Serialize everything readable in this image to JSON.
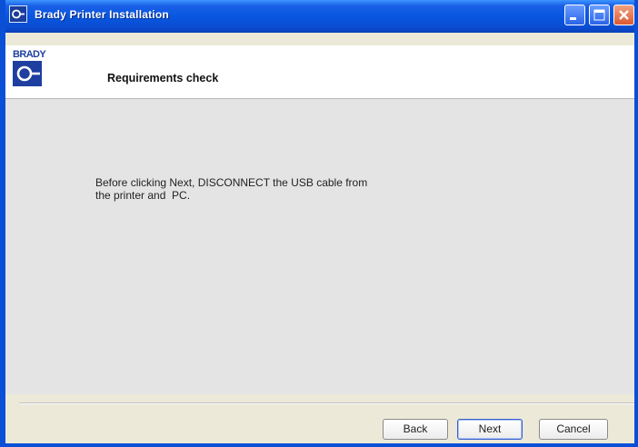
{
  "window": {
    "title": "Brady Printer Installation",
    "controls": {
      "minimize": "minimize-icon",
      "maximize": "maximize-icon",
      "close": "close-icon"
    },
    "titlebar_color": "#0857e0"
  },
  "header": {
    "logo_text": "BRADY",
    "title": "Requirements check",
    "brand_color": "#1e3f9f"
  },
  "content": {
    "message_line1": "Before clicking Next, DISCONNECT the USB cable from",
    "message_line2": "the printer and  PC."
  },
  "buttons": {
    "back": "Back",
    "next": "Next",
    "cancel": "Cancel"
  }
}
